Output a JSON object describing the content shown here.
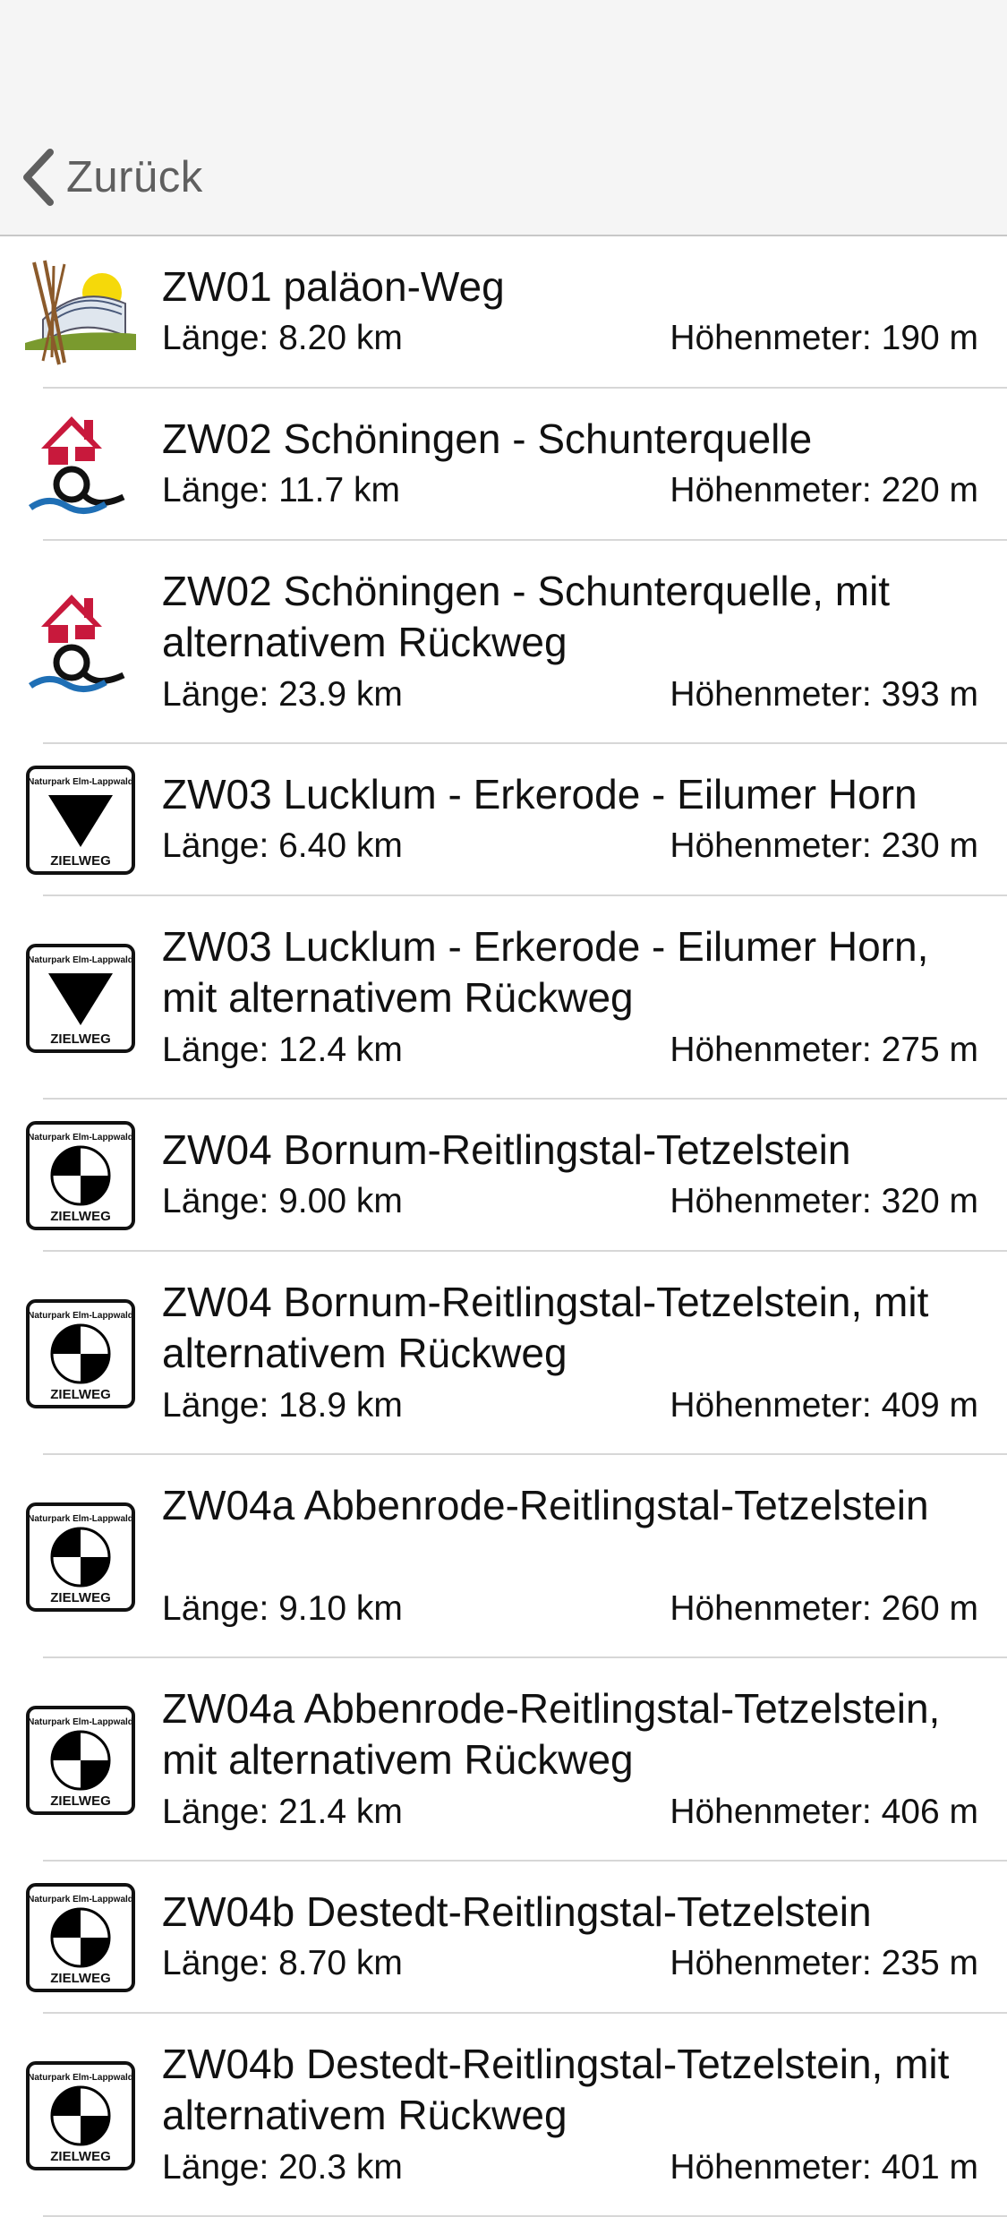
{
  "nav": {
    "back_label": "Zurück"
  },
  "routes": [
    {
      "icon": "palaeon-logo-icon",
      "title": "ZW01 paläon-Weg",
      "length": "Länge: 8.20 km",
      "elevation": "Höhenmeter: 190 m"
    },
    {
      "icon": "schunterquelle-logo-icon",
      "title": "ZW02 Schöningen - Schunterquelle",
      "length": "Länge: 11.7 km",
      "elevation": "Höhenmeter: 220 m"
    },
    {
      "icon": "schunterquelle-logo-icon",
      "title": "ZW02 Schöningen - Schunterquelle, mit alternativem Rückweg",
      "length": "Länge: 23.9 km",
      "elevation": "Höhenmeter: 393 m"
    },
    {
      "icon": "zielweg-triangle-icon",
      "title": "ZW03 Lucklum - Erkerode - Eilumer Horn",
      "length": "Länge: 6.40 km",
      "elevation": "Höhenmeter: 230 m"
    },
    {
      "icon": "zielweg-triangle-icon",
      "title": "ZW03 Lucklum - Erkerode - Eilumer Horn, mit alternativem Rückweg",
      "length": "Länge: 12.4 km",
      "elevation": "Höhenmeter: 275 m"
    },
    {
      "icon": "zielweg-quartered-circle-icon",
      "title": "ZW04 Bornum-Reitlingstal-Tetzelstein",
      "length": "Länge: 9.00 km",
      "elevation": "Höhenmeter: 320 m"
    },
    {
      "icon": "zielweg-quartered-circle-icon",
      "title": "ZW04 Bornum-Reitlingstal-Tetzelstein, mit alternativem Rückweg",
      "length": "Länge: 18.9 km",
      "elevation": "Höhenmeter: 409 m"
    },
    {
      "icon": "zielweg-quartered-circle-icon",
      "title": "ZW04a Abbenrode-Reitlingstal-Tetzelstein",
      "length": "Länge: 9.10 km",
      "elevation": "Höhenmeter: 260 m"
    },
    {
      "icon": "zielweg-quartered-circle-icon",
      "title": "ZW04a Abbenrode-Reitlingstal-Tetzelstein, mit alternativem Rückweg",
      "length": "Länge: 21.4 km",
      "elevation": "Höhenmeter: 406 m"
    },
    {
      "icon": "zielweg-quartered-circle-icon",
      "title": "ZW04b Destedt-Reitlingstal-Tetzelstein",
      "length": "Länge: 8.70 km",
      "elevation": "Höhenmeter: 235 m"
    },
    {
      "icon": "zielweg-quartered-circle-icon",
      "title": "ZW04b Destedt-Reitlingstal-Tetzelstein, mit alternativem Rückweg",
      "length": "Länge: 20.3 km",
      "elevation": "Höhenmeter: 401 m"
    }
  ],
  "signs": {
    "header_text": "Naturpark Elm-Lappwald",
    "footer_text": "ZIELWEG"
  },
  "colors": {
    "navbar_bg": "#f5f5f5",
    "back_text": "#5f5f5f",
    "separator": "#d7d7d7",
    "palaeon_sun": "#f5d90a",
    "palaeon_green": "#7a9a2e",
    "palaeon_brown": "#8b5a2b",
    "house_red": "#c8193c",
    "water_blue": "#1f6fb5"
  }
}
